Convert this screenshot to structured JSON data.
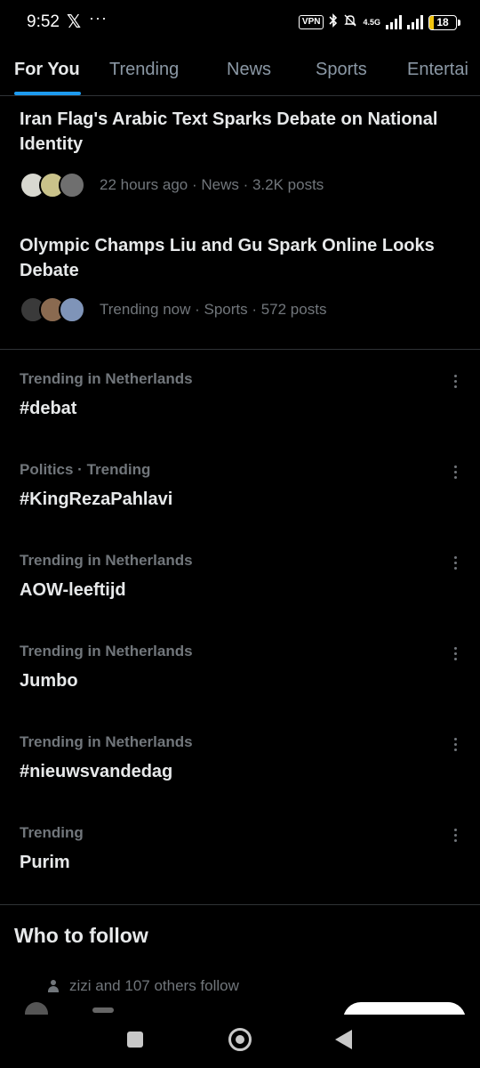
{
  "status_bar": {
    "time": "9:52",
    "x_logo": "𝕏",
    "more": "···",
    "vpn": "VPN",
    "bluetooth_icon": "bluetooth-icon",
    "mute_icon": "bell-off-icon",
    "network": "4.5G",
    "battery": "18",
    "battery_level": 0.18,
    "battery_color": "#f1c40f"
  },
  "tabs": [
    "For You",
    "Trending",
    "News",
    "Sports",
    "Entertai"
  ],
  "accent_color": "#1d9bf0",
  "news": [
    {
      "title": "Iran Flag's Arabic Text Sparks Debate on National Identity",
      "meta": "22 hours ago · News · 3.2K posts"
    },
    {
      "title": "Olympic Champs Liu and Gu Spark Online Looks Debate",
      "meta": "Trending now · Sports · 572 posts"
    }
  ],
  "trends": [
    {
      "context": "Trending in Netherlands",
      "name": "#debat"
    },
    {
      "context": "Politics · Trending",
      "name": "#KingRezaPahlavi"
    },
    {
      "context": "Trending in Netherlands",
      "name": "AOW-leeftijd"
    },
    {
      "context": "Trending in Netherlands",
      "name": "Jumbo"
    },
    {
      "context": "Trending in Netherlands",
      "name": "#nieuwsvandedag"
    },
    {
      "context": "Trending",
      "name": "Purim"
    }
  ],
  "who_to_follow": {
    "title": "Who to follow",
    "context": "zizi and 107 others follow"
  }
}
